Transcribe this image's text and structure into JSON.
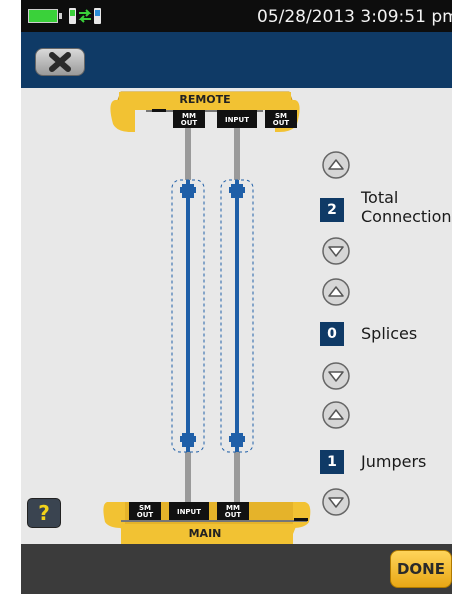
{
  "status_bar": {
    "datetime": "05/28/2013 3:09:51 pm",
    "battery_icon": "battery-full-icon",
    "link_icon": "instrument-link-icon"
  },
  "title_bar": {
    "back_icon": "close-x-icon"
  },
  "diagram": {
    "remote_label": "REMOTE",
    "main_label": "MAIN",
    "remote_ports": [
      "MM OUT",
      "INPUT",
      "SM OUT"
    ],
    "main_ports": [
      "SM OUT",
      "INPUT",
      "MM OUT"
    ],
    "port_label_lines": {
      "mm": [
        "MM",
        "OUT"
      ],
      "sm": [
        "SM",
        "OUT"
      ],
      "input": [
        "INPUT"
      ]
    }
  },
  "counters": [
    {
      "id": "total-connections",
      "value": "2",
      "label_line1": "Total",
      "label_line2": "Connections"
    },
    {
      "id": "splices",
      "value": "0",
      "label_line1": "Splices"
    },
    {
      "id": "jumpers",
      "value": "1",
      "label_line1": "Jumpers"
    }
  ],
  "bottom_bar": {
    "done_label": "DONE",
    "help_label": "?"
  },
  "colors": {
    "accent_blue": "#0f3a66",
    "fiber_blue": "#1f5fa8",
    "connector_yellow": "#f2c233",
    "done_yellow": "#f5b826"
  }
}
